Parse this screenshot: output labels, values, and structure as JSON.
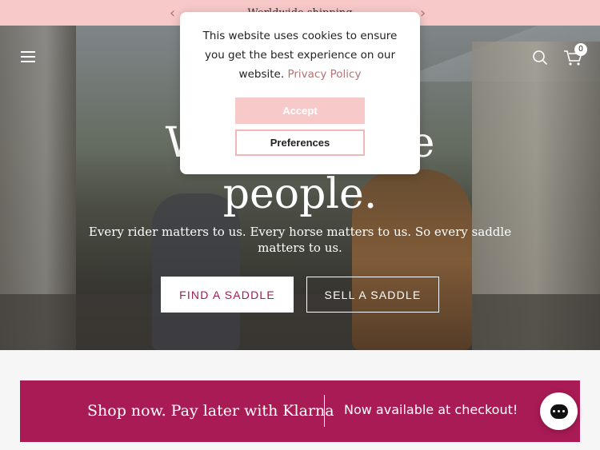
{
  "announcement": {
    "prev_icon": "chevron-left-icon",
    "next_icon": "chevron-right-icon",
    "prev_glyph": "‹",
    "next_glyph": "›",
    "message": "Worldwide shipping"
  },
  "header": {
    "menu_icon": "hamburger-menu-icon",
    "search_icon": "search-icon",
    "cart_icon": "cart-icon",
    "cart_count": "0"
  },
  "hero": {
    "headline_line1": "We … saddle",
    "headline_line2": "people.",
    "subtitle": "Every rider matters to us. Every horse matters to us. So every saddle matters to us.",
    "find_button": "FIND A SADDLE",
    "sell_button": "SELL A SADDLE"
  },
  "cookie_modal": {
    "message": "This website uses cookies to ensure you get the best experience on our website.",
    "privacy_link": "Privacy Policy",
    "accept_label": "Accept",
    "preferences_label": "Preferences"
  },
  "klarna_banner": {
    "left_text": "Shop now. Pay later with Klarna",
    "right_text": "Now available at checkout!"
  },
  "chat": {
    "icon": "chat-bubble-icon"
  },
  "colors": {
    "announcement_bg": "#f7c9c9",
    "brand_magenta": "#a91b55",
    "accept_bg": "#f7c9c9"
  }
}
